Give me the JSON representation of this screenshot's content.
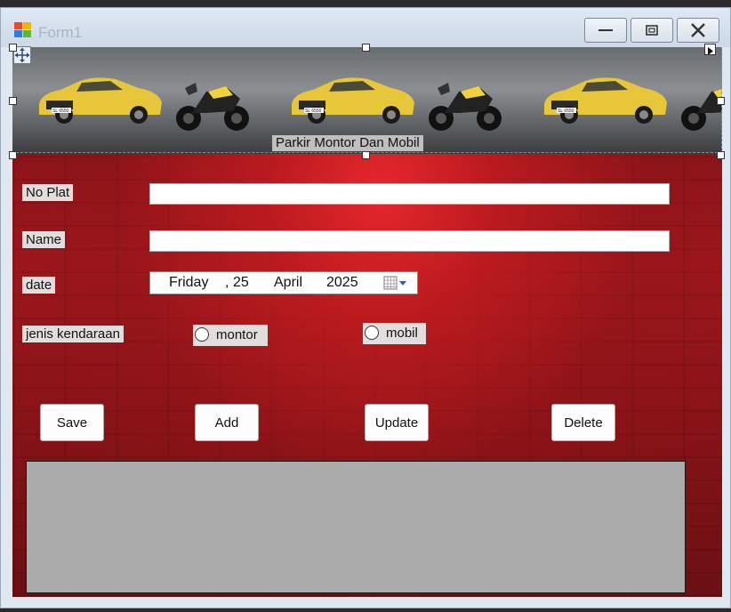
{
  "window": {
    "title": "Form1"
  },
  "banner": {
    "title": "Parkir Montor Dan Mobil",
    "plate_text": "SL 6550"
  },
  "form": {
    "no_plat_label": "No Plat",
    "no_plat_value": "",
    "name_label": "Name",
    "name_value": "",
    "date_label": "date",
    "date": {
      "day_name": "Friday",
      "sep": ",",
      "day": "25",
      "month": "April",
      "year": "2025"
    },
    "jenis_label": "jenis kendaraan",
    "option_motor": "montor",
    "option_mobil": "mobil"
  },
  "buttons": {
    "save": "Save",
    "add": "Add",
    "update": "Update",
    "delete": "Delete"
  },
  "colors": {
    "car": "#e8c63a",
    "bike_tank": "#f0d23a",
    "client_red": "#9c171c",
    "grid_bg": "#ababab"
  }
}
